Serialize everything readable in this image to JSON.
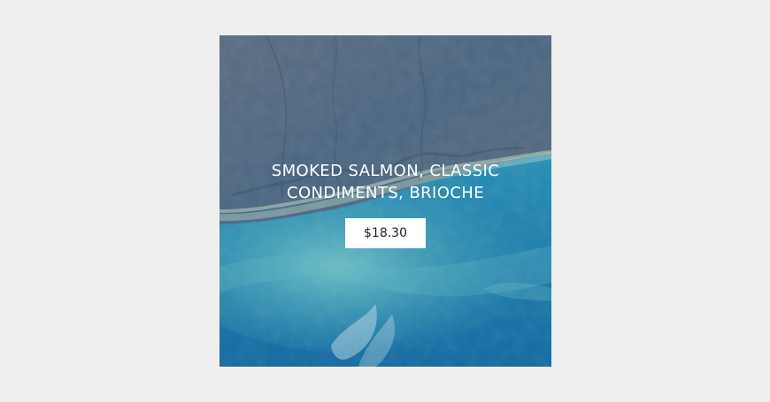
{
  "product": {
    "title_line_1": "SMOKED SALMON, CLASSIC",
    "title_line_2": "CONDIMENTS, BRIOCHE",
    "price_label": "$18.30"
  },
  "colors": {
    "page_background": "#efefef",
    "button_background": "#ffffff",
    "title_text": "#ffffff",
    "price_text": "#222222"
  }
}
